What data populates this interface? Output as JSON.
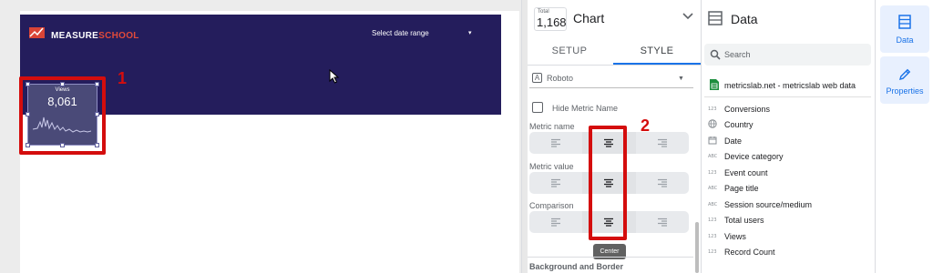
{
  "canvas": {
    "logo": {
      "prefix": "MEASURE",
      "suffix": "SCHOOL"
    },
    "date_range": {
      "label": "Select date range"
    },
    "scorecard": {
      "metric_name": "Views",
      "metric_value": "8,061"
    },
    "annotations": {
      "step1": "1",
      "step2": "2"
    },
    "annotation_color": "#d40d0d",
    "header_color": "#241d5c"
  },
  "chart_panel": {
    "total": {
      "label": "Total",
      "value": "1,168"
    },
    "title": "Chart",
    "tabs": [
      {
        "label": "SETUP"
      },
      {
        "label": "STYLE"
      }
    ],
    "active_tab": "STYLE",
    "font": {
      "name": "Roboto"
    },
    "hide_metric_name": {
      "label": "Hide Metric Name",
      "checked": false
    },
    "sections": {
      "metric_name": "Metric name",
      "metric_value": "Metric value",
      "comparison": "Comparison"
    },
    "selected_alignment": "center",
    "tooltip": "Center",
    "background_border": "Background and Border"
  },
  "data_panel": {
    "title": "Data",
    "search": {
      "placeholder": "Search"
    },
    "source": {
      "name": "metricslab.net - metricslab web data"
    },
    "fields": [
      {
        "type": "123",
        "name": "Conversions"
      },
      {
        "type": "globe-icon",
        "name": "Country"
      },
      {
        "type": "calendar-icon",
        "name": "Date"
      },
      {
        "type": "ABC",
        "name": "Device category"
      },
      {
        "type": "123",
        "name": "Event count"
      },
      {
        "type": "ABC",
        "name": "Page title"
      },
      {
        "type": "ABC",
        "name": "Session source/medium"
      },
      {
        "type": "123",
        "name": "Total users"
      },
      {
        "type": "123",
        "name": "Views"
      },
      {
        "type": "123",
        "name": "Record Count"
      }
    ]
  },
  "right_rail": {
    "data_label": "Data",
    "properties_label": "Properties",
    "accent": "#1a73e8"
  }
}
